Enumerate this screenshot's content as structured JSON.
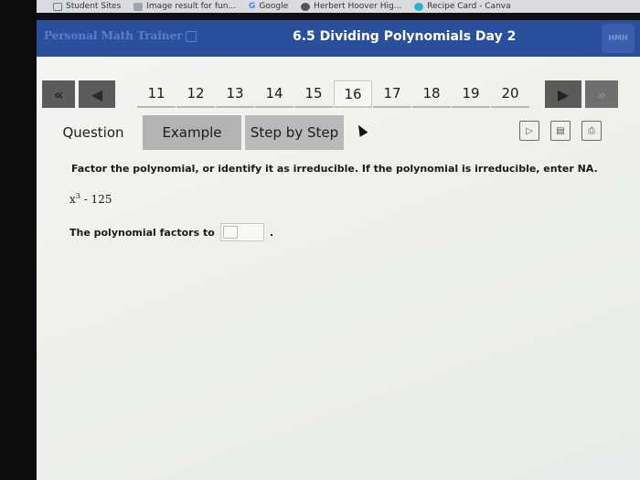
{
  "bookmarks": [
    {
      "label": "Student Sites",
      "icon": "folder-icon",
      "color": "#6b7a8c"
    },
    {
      "label": "Image result for fun...",
      "icon": "image-icon",
      "color": "#7e8a9a"
    },
    {
      "label": "Google",
      "icon": "google-icon",
      "color": "#4285f4"
    },
    {
      "label": "Herbert Hoover Hig...",
      "icon": "school-icon",
      "color": "#444"
    },
    {
      "label": "Recipe Card - Canva",
      "icon": "canva-icon",
      "color": "#2bb5c9"
    }
  ],
  "header": {
    "brand": "Personal Math Trainer",
    "title": "6.5 Dividing Polynomials Day 2",
    "logo": "HMH"
  },
  "nav": {
    "first_icon": "«",
    "prev_icon": "◀",
    "next_icon": "▶",
    "last_icon": "»",
    "questions": [
      "11",
      "12",
      "13",
      "14",
      "15",
      "16",
      "17",
      "18",
      "19",
      "20"
    ],
    "active": "16"
  },
  "tabs": {
    "question": "Question",
    "example": "Example",
    "step": "Step by Step"
  },
  "tools": {
    "video_icon": "▷",
    "book_icon": "▤",
    "print_icon": "⎙"
  },
  "question": {
    "instructions": "Factor the polynomial, or identify it as irreducible. If the polynomial is irreducible, enter NA.",
    "expression_base": "x",
    "expression_exp": "3",
    "expression_rest": " - 125",
    "answer_prompt": "The polynomial factors to",
    "answer_value": "",
    "period": "."
  },
  "colors": {
    "header_bg": "#2a4f9c",
    "tab_bg": "#b3b3b3",
    "nav_btn": "#5b5b5b"
  }
}
